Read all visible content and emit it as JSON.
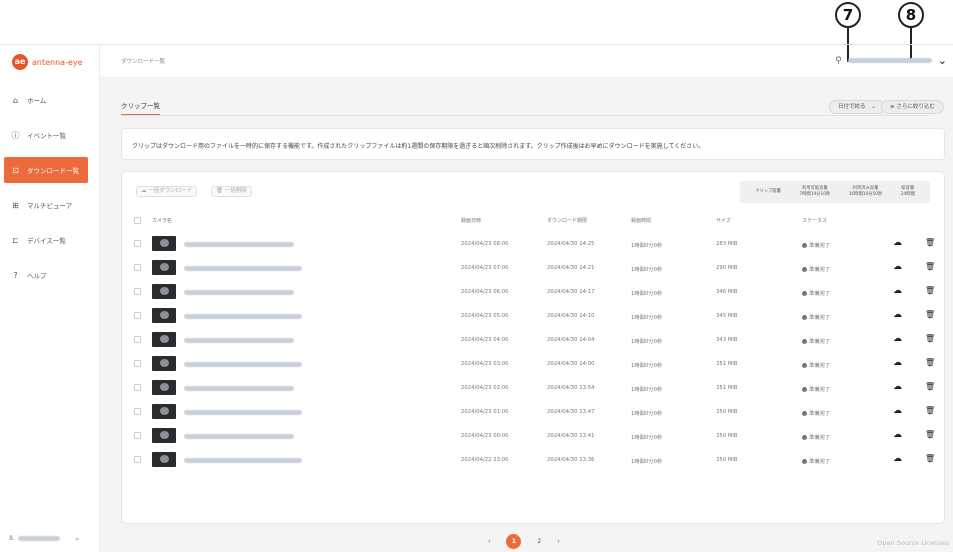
{
  "callouts": {
    "c7": "7",
    "c8": "8"
  },
  "sidebar": {
    "brand": "antenna-eye",
    "brand_mark": "ae",
    "items": [
      {
        "label": "ホーム",
        "icon": "home-icon",
        "glyph": "⌂",
        "active": false
      },
      {
        "label": "イベント一覧",
        "icon": "info-icon",
        "glyph": "ⓘ",
        "active": false
      },
      {
        "label": "ダウンロード一覧",
        "icon": "download-icon",
        "glyph": "⊡",
        "active": true
      },
      {
        "label": "マルチビューア",
        "icon": "grid-icon",
        "glyph": "⊞",
        "active": false
      },
      {
        "label": "デバイス一覧",
        "icon": "camera-icon",
        "glyph": "⊏",
        "active": false
      },
      {
        "label": "ヘルプ",
        "icon": "help-icon",
        "glyph": "?",
        "active": false
      }
    ],
    "footer_chevron": "⌄"
  },
  "header": {
    "breadcrumb": "ダウンロード一覧",
    "user_chevron": "⌄"
  },
  "main": {
    "tab_label": "クリップ一覧",
    "sort_button": "日付で絞る",
    "filter_button": "さらに絞り込む",
    "notice": "クリップはダウンロード用のファイルを一時的に保存する機能です。作成されたクリップファイルは約1週間の保存期限を過ぎると順次削除されます。クリップ作成後はお早めにダウンロードを実施してください。",
    "bulk_download": "一括ダウンロード",
    "bulk_delete": "一括削除",
    "stats": {
      "label": "クリップ容量",
      "available_label": "利用可能容量",
      "available_value": "7時間19分10秒",
      "used_label": "利用済み容量",
      "used_value": "16時間10分50秒",
      "total_label": "総容量",
      "total_value": "24時間"
    },
    "columns": [
      "カメラ名",
      "録画日時",
      "ダウンロード期限",
      "録画時間",
      "サイズ",
      "ステータス"
    ],
    "rows": [
      {
        "recorded": "2024/04/23 08:00",
        "expires": "2024/04/30 14:25",
        "duration": "1時間0分0秒",
        "size": "283 MiB",
        "status": "準備完了"
      },
      {
        "recorded": "2024/04/23 07:00",
        "expires": "2024/04/30 14:21",
        "duration": "1時間0分0秒",
        "size": "290 MiB",
        "status": "準備完了"
      },
      {
        "recorded": "2024/04/23 06:00",
        "expires": "2024/04/30 14:17",
        "duration": "1時間0分0秒",
        "size": "346 MiB",
        "status": "準備完了"
      },
      {
        "recorded": "2024/04/23 05:00",
        "expires": "2024/04/30 14:10",
        "duration": "1時間0分0秒",
        "size": "345 MiB",
        "status": "準備完了"
      },
      {
        "recorded": "2024/04/23 04:00",
        "expires": "2024/04/30 14:04",
        "duration": "1時間0分0秒",
        "size": "343 MiB",
        "status": "準備完了"
      },
      {
        "recorded": "2024/04/23 03:00",
        "expires": "2024/04/30 14:00",
        "duration": "1時間0分0秒",
        "size": "351 MiB",
        "status": "準備完了"
      },
      {
        "recorded": "2024/04/23 02:00",
        "expires": "2024/04/30 13:54",
        "duration": "1時間0分0秒",
        "size": "351 MiB",
        "status": "準備完了"
      },
      {
        "recorded": "2024/04/23 01:00",
        "expires": "2024/04/30 13:47",
        "duration": "1時間0分0秒",
        "size": "350 MiB",
        "status": "準備完了"
      },
      {
        "recorded": "2024/04/23 00:00",
        "expires": "2024/04/30 13:41",
        "duration": "1時間0分0秒",
        "size": "350 MiB",
        "status": "準備完了"
      },
      {
        "recorded": "2024/04/22 23:00",
        "expires": "2024/04/30 13:36",
        "duration": "1時間0分0秒",
        "size": "350 MiB",
        "status": "準備完了"
      }
    ],
    "pager": {
      "prev": "‹",
      "current": "1",
      "next_page": "2",
      "next": "›"
    }
  },
  "footer": {
    "oss": "Open Source Licenses"
  },
  "colors": {
    "accent": "#ec6a3c",
    "brand": "#e8552b"
  }
}
